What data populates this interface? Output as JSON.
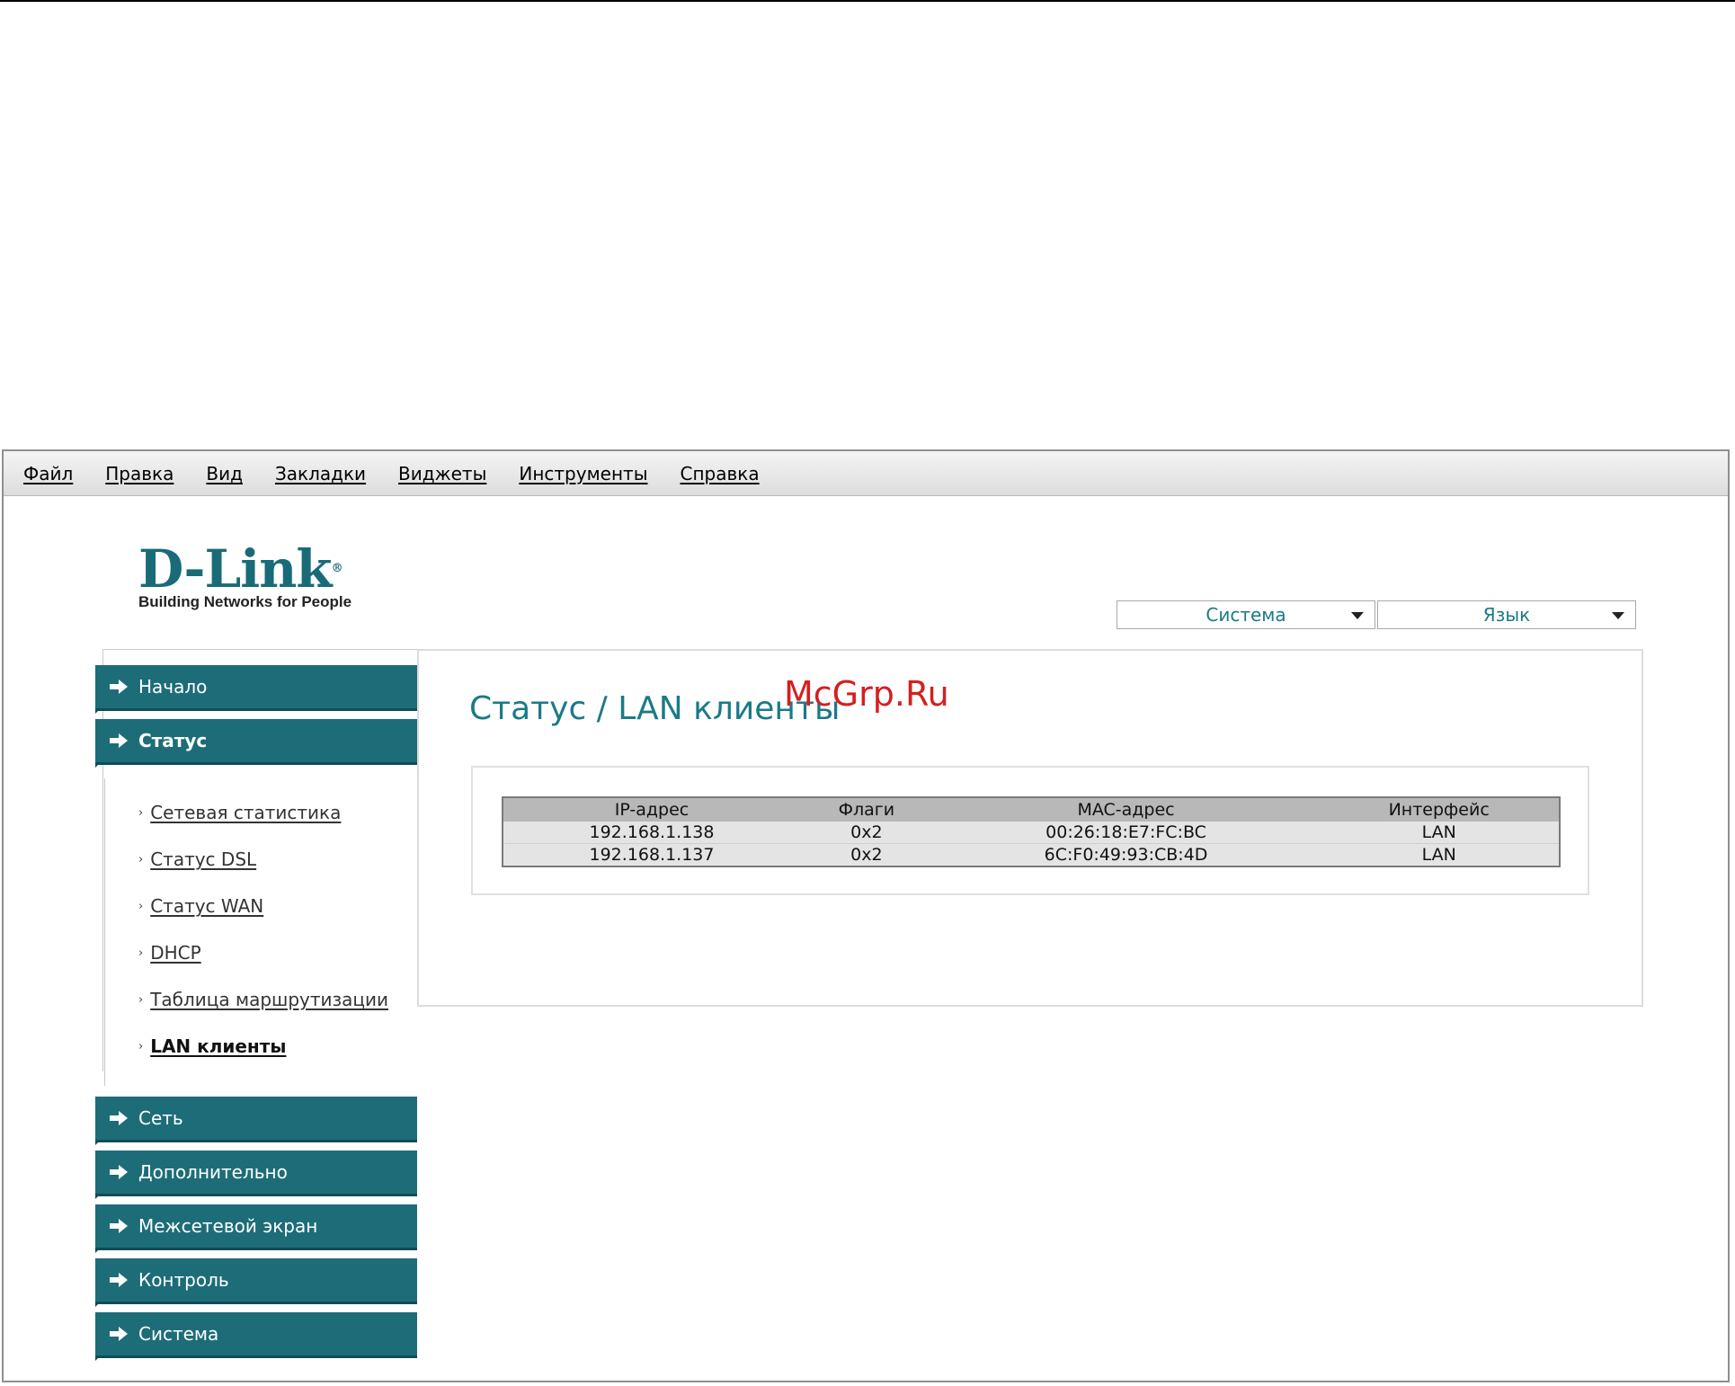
{
  "menubar": {
    "items": [
      "Файл",
      "Правка",
      "Вид",
      "Закладки",
      "Виджеты",
      "Инструменты",
      "Справка"
    ]
  },
  "logo": {
    "brand": "D-Link",
    "registered": "®",
    "tagline": "Building Networks for People"
  },
  "header": {
    "system_select": "Система",
    "language_select": "Язык"
  },
  "sidebar": {
    "sections": [
      {
        "label": "Начало"
      },
      {
        "label": "Статус"
      },
      {
        "label": "Сеть"
      },
      {
        "label": "Дополнительно"
      },
      {
        "label": "Межсетевой экран"
      },
      {
        "label": "Контроль"
      },
      {
        "label": "Система"
      }
    ],
    "status_items": [
      {
        "label": "Сетевая статистика"
      },
      {
        "label": "Статус DSL"
      },
      {
        "label": "Статус WAN"
      },
      {
        "label": "DHCP"
      },
      {
        "label": "Таблица маршрутизации"
      },
      {
        "label": "LAN клиенты"
      }
    ]
  },
  "main": {
    "title": "Статус / LAN клиенты",
    "table": {
      "columns": [
        "IP-адрес",
        "Флаги",
        "MAC-адрес",
        "Интерфейс"
      ],
      "rows": [
        [
          "192.168.1.138",
          "0x2",
          "00:26:18:E7:FC:BC",
          "LAN"
        ],
        [
          "192.168.1.137",
          "0x2",
          "6C:F0:49:93:CB:4D",
          "LAN"
        ]
      ]
    }
  },
  "watermark": "McGrp.Ru",
  "colors": {
    "accent": "#1d6d78",
    "title": "#1b7a87"
  }
}
